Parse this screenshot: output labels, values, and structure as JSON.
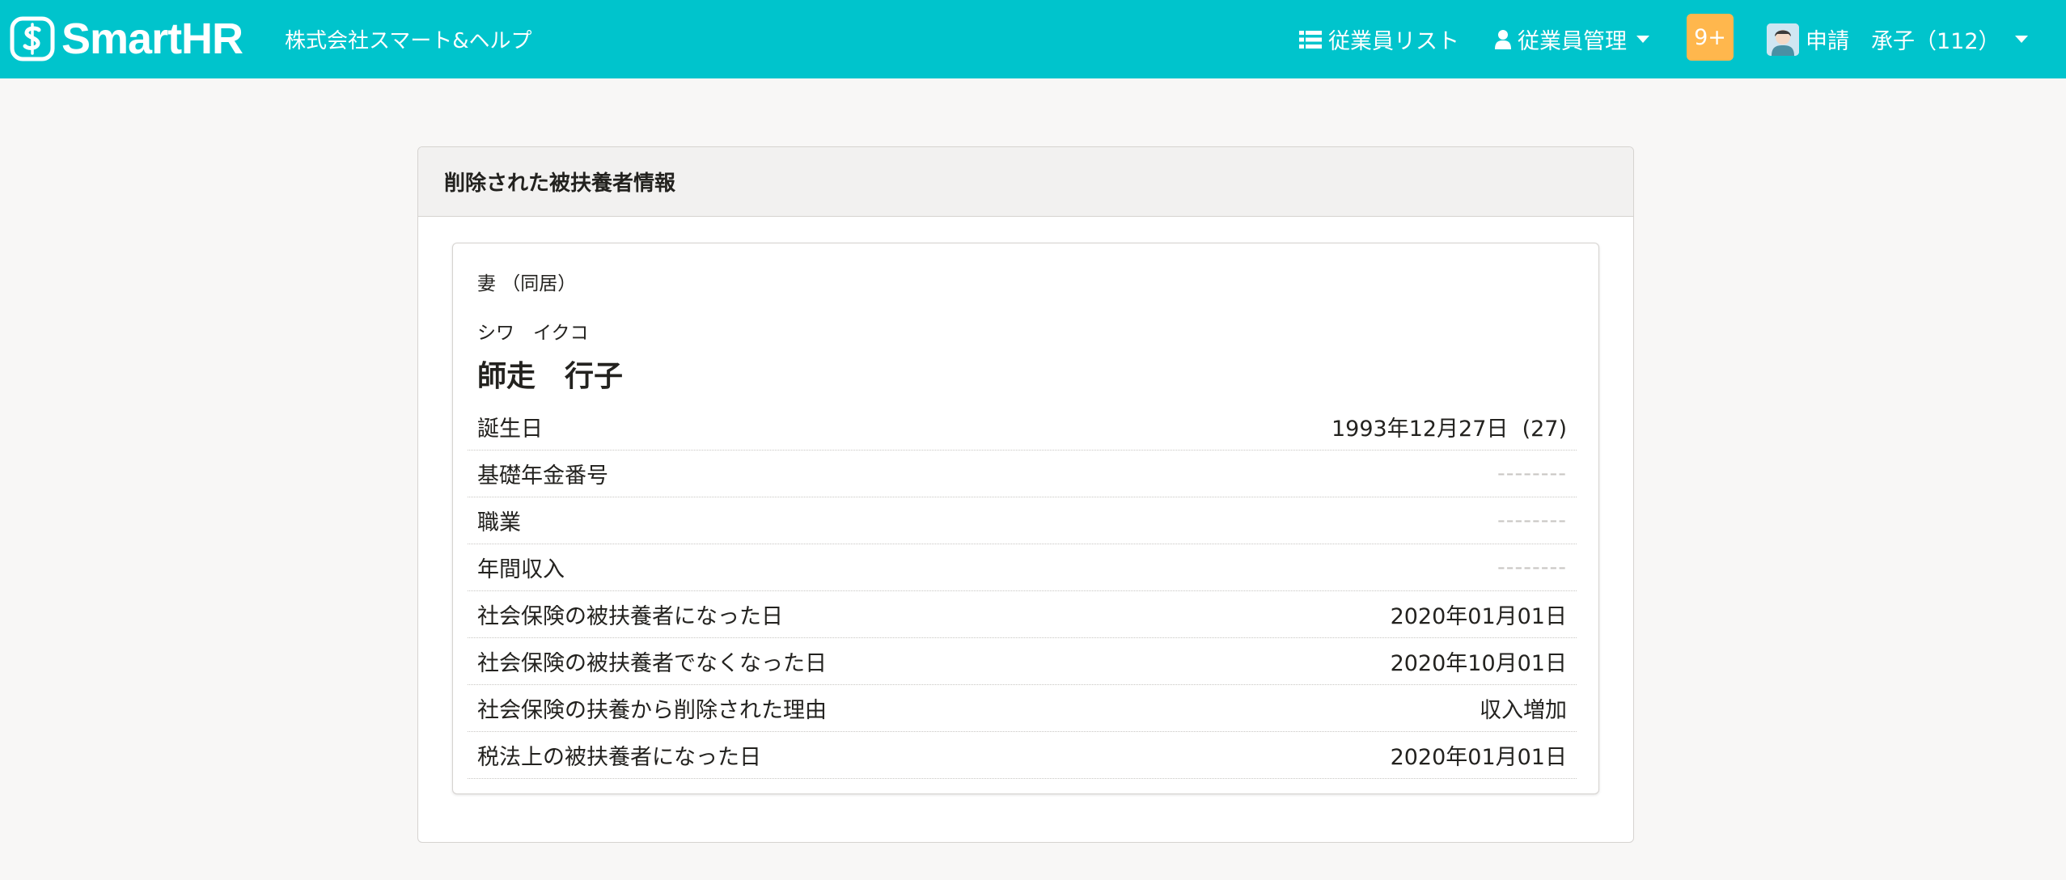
{
  "header": {
    "brand": "SmartHR",
    "company": "株式会社スマート&ヘルプ",
    "nav": {
      "employee_list": "従業員リスト",
      "employee_manage": "従業員管理"
    },
    "notification_badge": "9+",
    "user": "申請　承子（112）",
    "colors": {
      "bar": "#00c4cc",
      "badge": "#ffb74d"
    }
  },
  "panel": {
    "title": "削除された被扶養者情報"
  },
  "dependent": {
    "relation": "妻 （同居）",
    "kana": "シワ　イクコ",
    "name": "師走　行子",
    "rows": [
      {
        "label": "誕生日",
        "value": "1993年12月27日  (27)",
        "empty": false
      },
      {
        "label": "基礎年金番号",
        "value": "--------",
        "empty": true
      },
      {
        "label": "職業",
        "value": "--------",
        "empty": true
      },
      {
        "label": "年間収入",
        "value": "--------",
        "empty": true
      },
      {
        "label": "社会保険の被扶養者になった日",
        "value": "2020年01月01日",
        "empty": false
      },
      {
        "label": "社会保険の被扶養者でなくなった日",
        "value": "2020年10月01日",
        "empty": false
      },
      {
        "label": "社会保険の扶養から削除された理由",
        "value": "収入増加",
        "empty": false
      },
      {
        "label": "税法上の被扶養者になった日",
        "value": "2020年01月01日",
        "empty": false
      }
    ]
  }
}
